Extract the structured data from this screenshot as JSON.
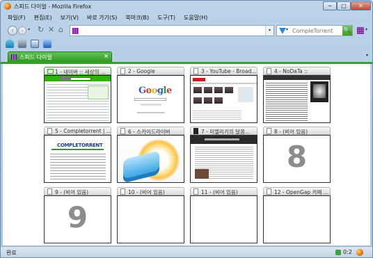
{
  "window": {
    "title": "스피드 다이얼 - Mozilla Firefox",
    "min_label": "─",
    "max_label": "□",
    "close_label": "✕"
  },
  "menu": [
    "파일(F)",
    "편집(E)",
    "보기(V)",
    "바로 가기(S)",
    "북마크(B)",
    "도구(T)",
    "도움말(H)"
  ],
  "nav": {
    "back": "‹",
    "forward": "›",
    "drop": "▾",
    "reload": "↻",
    "stop": "✕",
    "home": "⌂",
    "url_value": "",
    "url_drop": "▾"
  },
  "search": {
    "placeholder": "CompleTorrent",
    "drop": "▾",
    "go": "🔍"
  },
  "tab": {
    "label": "스피드 다이얼",
    "close": "×",
    "list": "▾"
  },
  "dials": [
    {
      "title": "1 - 네이버 :: 세상의 ...",
      "type": "naver"
    },
    {
      "title": "2 - Google",
      "type": "google"
    },
    {
      "title": "3 - YouTube - Broad...",
      "type": "youtube"
    },
    {
      "title": "4 - NoDaTa ::",
      "type": "nodata"
    },
    {
      "title": "5 - Completorrent | ...",
      "type": "compl"
    },
    {
      "title": "6 - 스카이드라이버",
      "type": "sky"
    },
    {
      "title": "7 - 미엘리키의 달콤...",
      "type": "mier"
    },
    {
      "title": "8 - (비어 있음)",
      "type": "empty",
      "number": "8"
    },
    {
      "title": "9 - (비어 있음)",
      "type": "empty",
      "number": "9"
    },
    {
      "title": "10 - (비어 있음)",
      "type": "empty",
      "number": ""
    },
    {
      "title": "11 - (비어 있음)",
      "type": "empty",
      "number": ""
    },
    {
      "title": "12 - OpenGap 카페 ...",
      "type": "empty",
      "number": ""
    }
  ],
  "thumb_text": {
    "google_logo": "Google",
    "compl_logo": "COMPLETORRENT"
  },
  "status": {
    "text": "완료",
    "counter": "0:2"
  }
}
